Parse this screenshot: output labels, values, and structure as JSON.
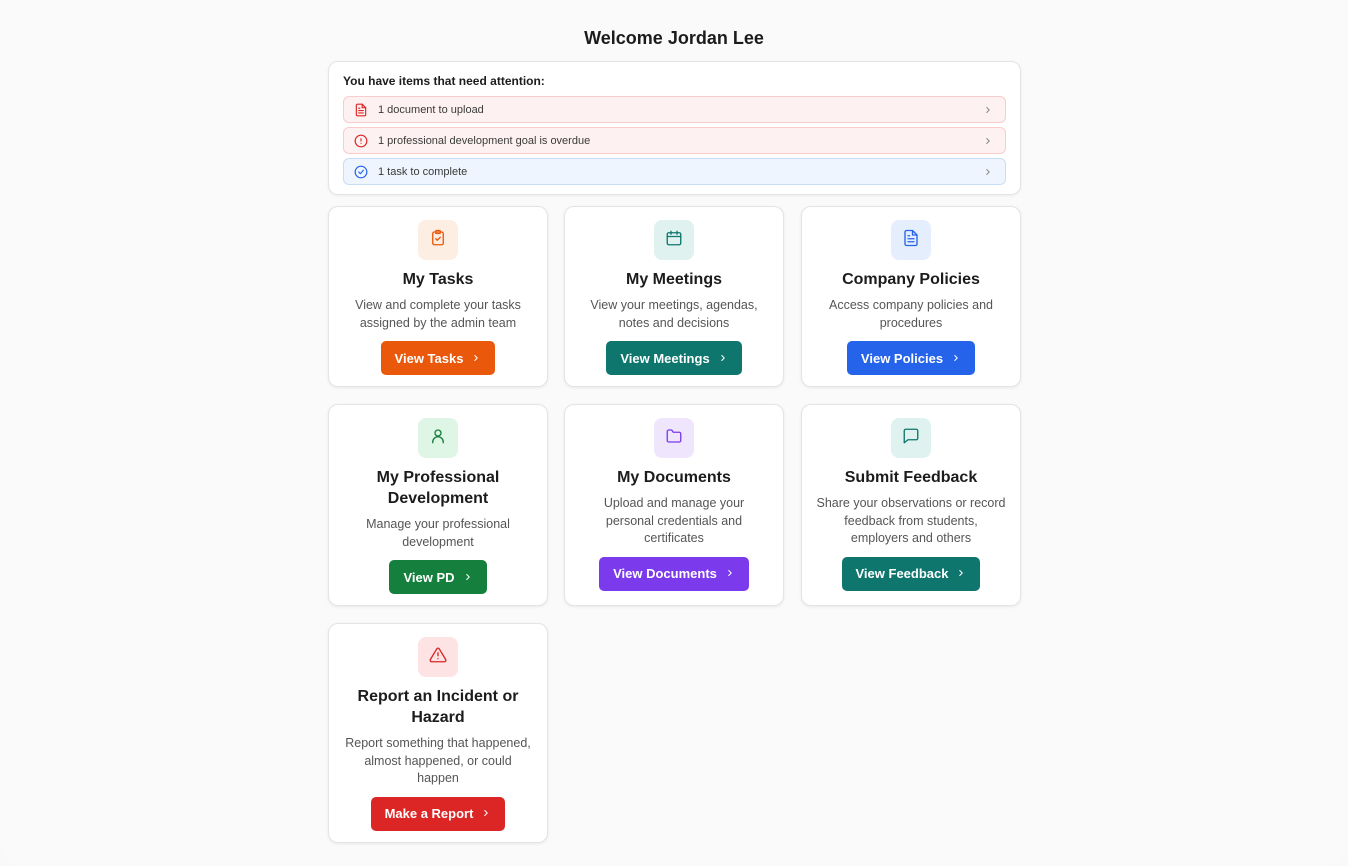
{
  "welcome": "Welcome Jordan Lee",
  "attention": {
    "title": "You have items that need attention:",
    "items": [
      {
        "label": "1 document to upload",
        "icon": "document-icon",
        "tone": "red"
      },
      {
        "label": "1 professional development goal is overdue",
        "icon": "alert-circle-icon",
        "tone": "red"
      },
      {
        "label": "1 task to complete",
        "icon": "check-circle-icon",
        "tone": "blue"
      }
    ]
  },
  "cards": [
    {
      "title": "My Tasks",
      "desc": "View and complete your tasks assigned by the admin team",
      "button": "View Tasks",
      "icon": "clipboard-check-icon",
      "accent": "#ea580c",
      "icon_bg": "#fdeee3"
    },
    {
      "title": "My Meetings",
      "desc": "View your meetings, agendas, notes and decisions",
      "button": "View Meetings",
      "icon": "calendar-icon",
      "accent": "#0f766e",
      "icon_bg": "#dff2ef"
    },
    {
      "title": "Company Policies",
      "desc": "Access company policies and procedures",
      "button": "View Policies",
      "icon": "document-text-icon",
      "accent": "#2563eb",
      "icon_bg": "#e5eefd"
    },
    {
      "title": "My Professional Development",
      "desc": "Manage your professional development",
      "button": "View PD",
      "icon": "user-icon",
      "accent": "#15803d",
      "icon_bg": "#dff5e6"
    },
    {
      "title": "My Documents",
      "desc": "Upload and manage your personal credentials and certificates",
      "button": "View Documents",
      "icon": "folder-icon",
      "accent": "#7c3aed",
      "icon_bg": "#efe6fd"
    },
    {
      "title": "Submit Feedback",
      "desc": "Share your observations or record feedback from students, employers and others",
      "button": "View Feedback",
      "icon": "message-square-icon",
      "accent": "#0f766e",
      "icon_bg": "#dff2ef"
    },
    {
      "title": "Report an Incident or Hazard",
      "desc": "Report something that happened, almost happened, or could happen",
      "button": "Make a Report",
      "icon": "warning-triangle-icon",
      "accent": "#dc2626",
      "icon_bg": "#fde3e3"
    }
  ]
}
